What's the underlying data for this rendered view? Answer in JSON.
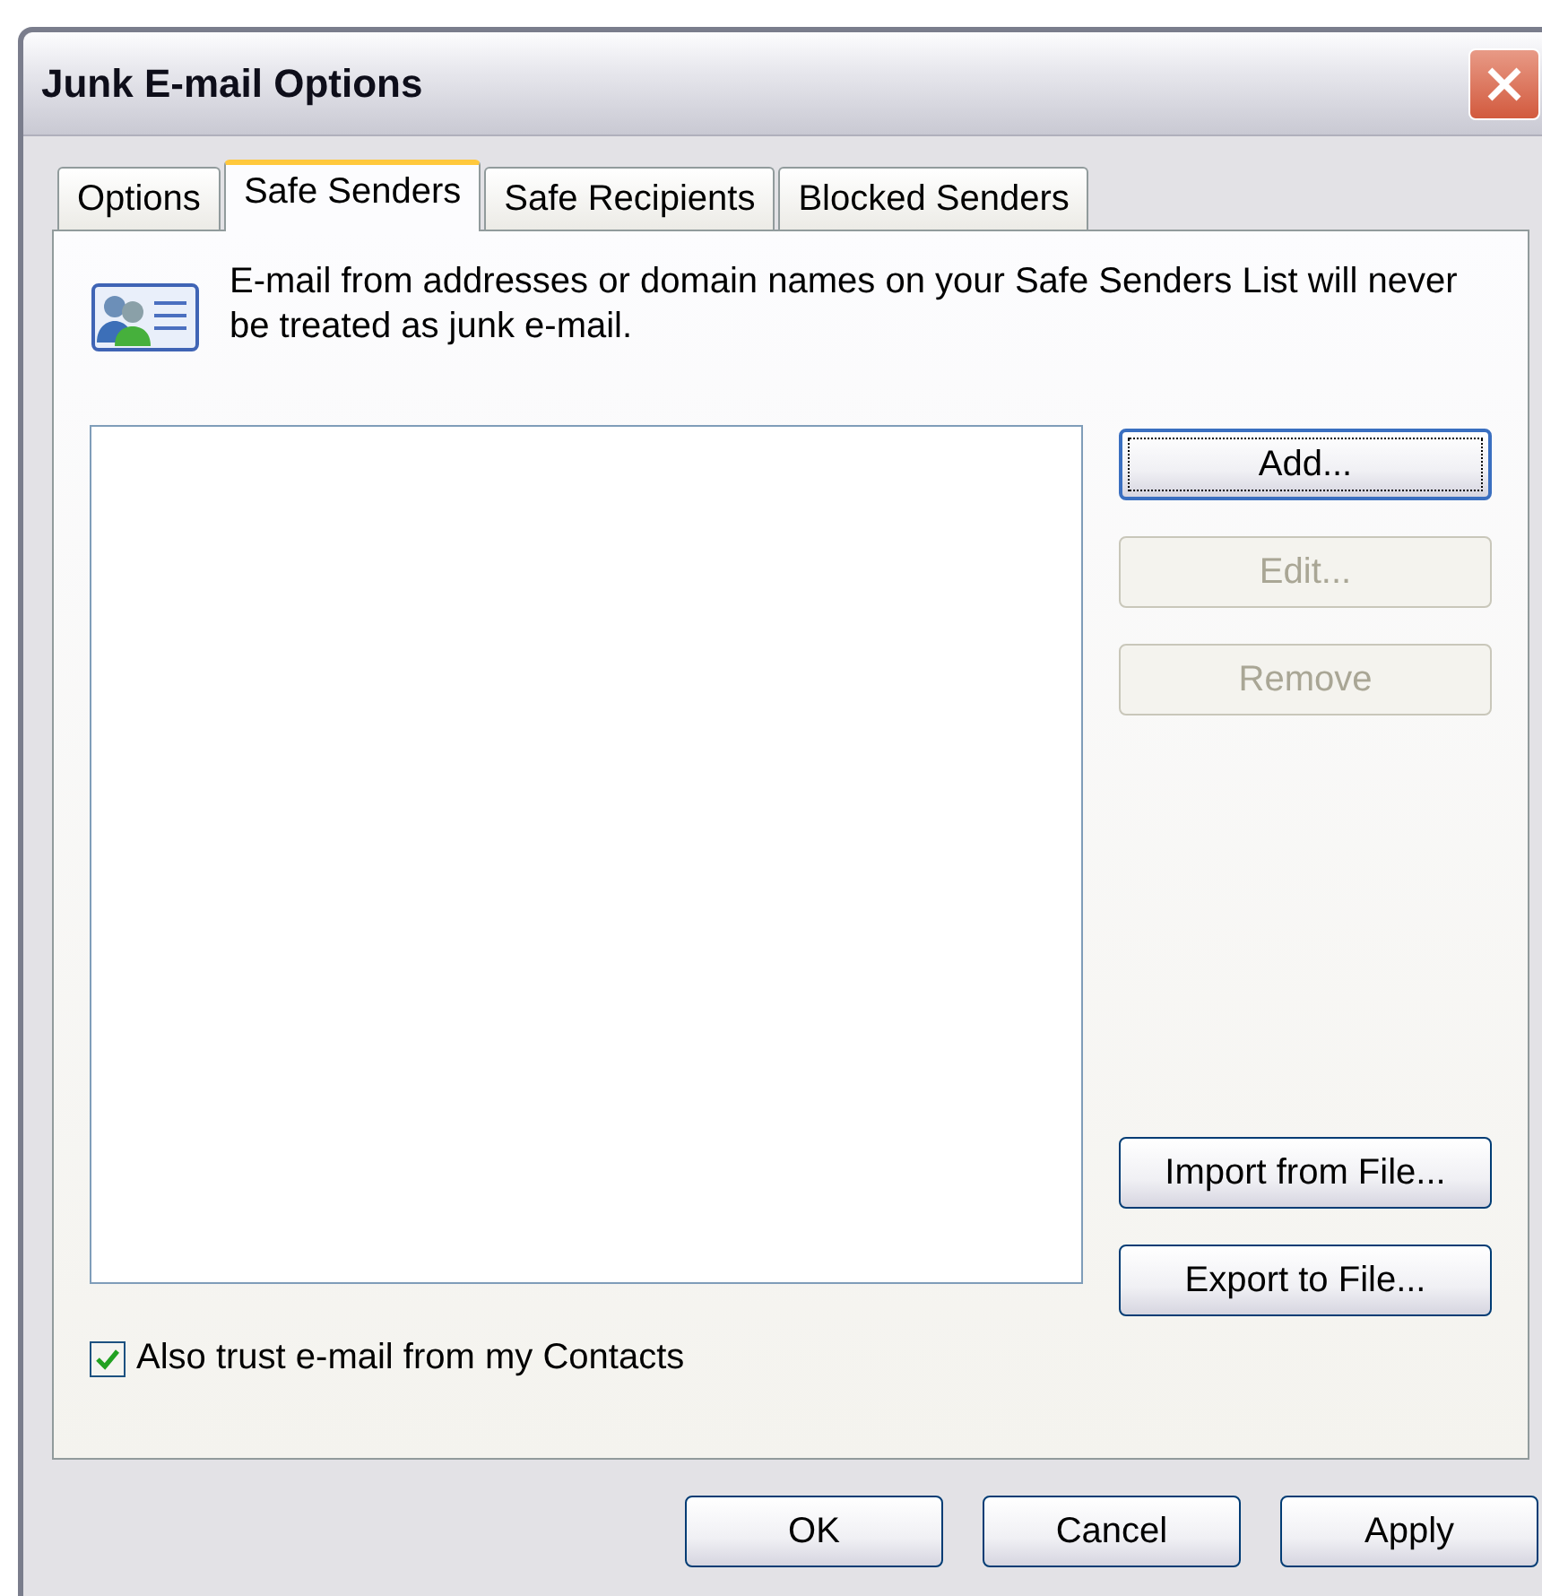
{
  "window": {
    "title": "Junk E-mail Options"
  },
  "tabs": [
    {
      "label": "Options",
      "selected": false
    },
    {
      "label": "Safe Senders",
      "selected": true
    },
    {
      "label": "Safe Recipients",
      "selected": false
    },
    {
      "label": "Blocked Senders",
      "selected": false
    }
  ],
  "info": {
    "text": "E-mail from addresses or domain names on your Safe Senders List will never be treated as junk e-mail."
  },
  "list_buttons": [
    {
      "label": "Add...",
      "disabled": false,
      "focused": true
    },
    {
      "label": "Edit...",
      "disabled": true,
      "focused": false
    },
    {
      "label": "Remove",
      "disabled": true,
      "focused": false
    }
  ],
  "file_buttons": [
    {
      "label": "Import from File...",
      "disabled": false,
      "focused": false
    },
    {
      "label": "Export to File...",
      "disabled": false,
      "focused": false
    }
  ],
  "checkbox": {
    "label": "Also trust e-mail from my Contacts",
    "checked": true
  },
  "dialog_buttons": [
    {
      "label": "OK",
      "disabled": false,
      "focused": false
    },
    {
      "label": "Cancel",
      "disabled": false,
      "focused": false
    },
    {
      "label": "Apply",
      "disabled": false,
      "focused": false
    }
  ]
}
